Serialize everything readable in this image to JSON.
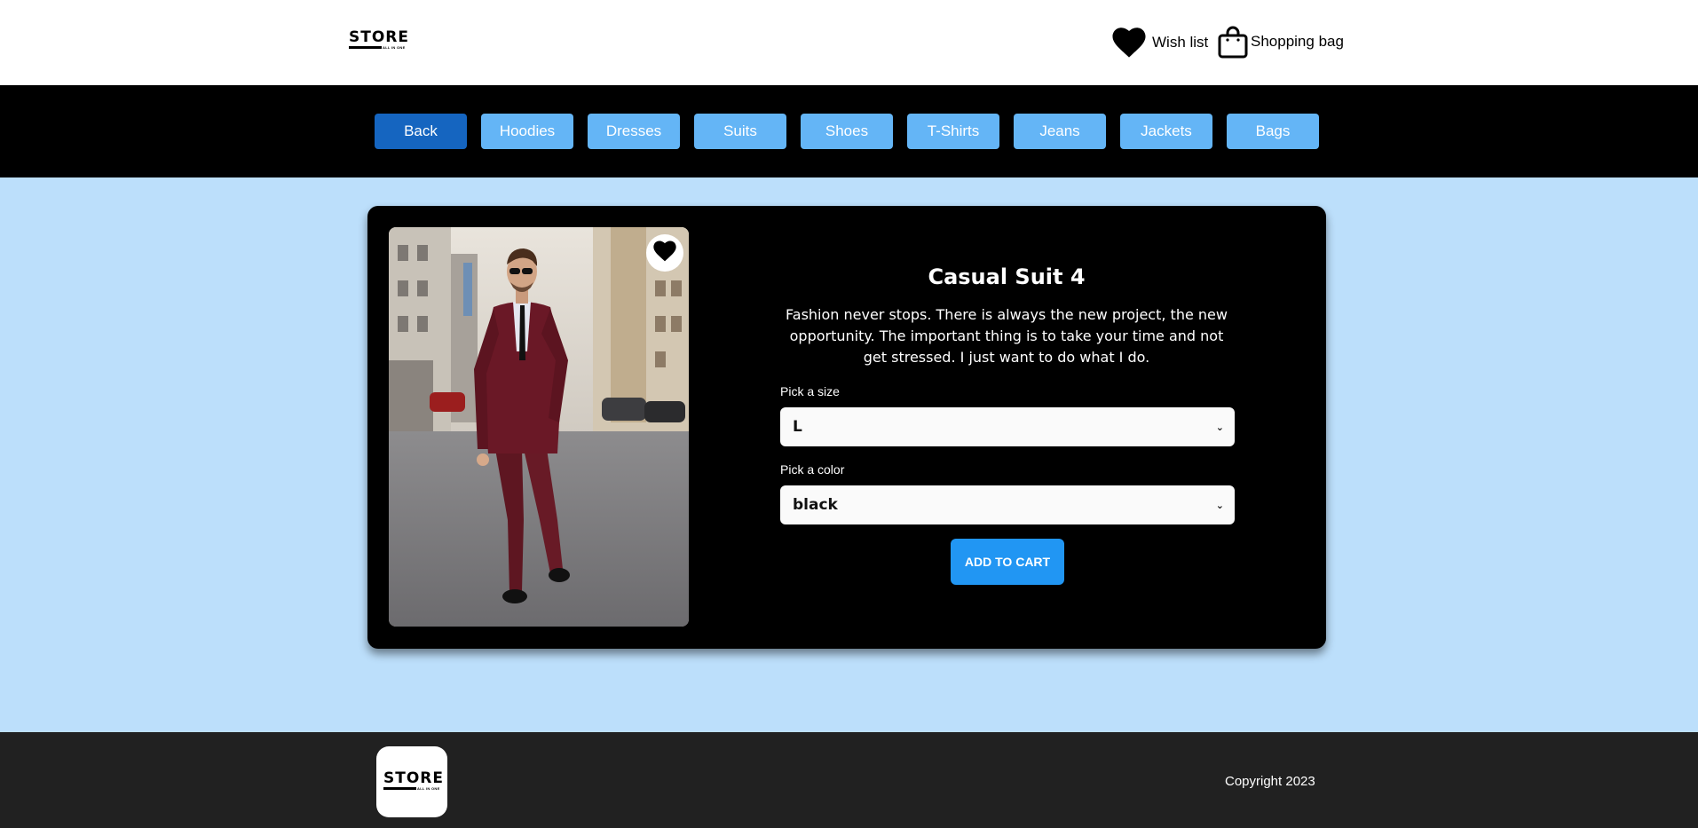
{
  "header": {
    "logo": {
      "word": "STORE",
      "tagline": "ALL IN ONE"
    },
    "wishlist_label": "Wish list",
    "bag_label": "Shopping bag"
  },
  "nav": {
    "items": [
      "Back",
      "Hoodies",
      "Dresses",
      "Suits",
      "Shoes",
      "T-Shirts",
      "Jeans",
      "Jackets",
      "Bags"
    ],
    "active": "Back"
  },
  "product": {
    "title": "Casual Suit 4",
    "description": "Fashion never stops. There is always the new project, the new opportunity. The important thing is to take your time and not get stressed. I just want to do what I do.",
    "size_label": "Pick a size",
    "size_value": "L",
    "color_label": "Pick a color",
    "color_value": "black",
    "add_label": "ADD TO CART"
  },
  "footer": {
    "copyright": "Copyright 2023"
  },
  "colors": {
    "page_bg": "#bcdffb",
    "nav_bg": "#000000",
    "nav_btn": "#64b5f6",
    "nav_btn_active": "#1565c0",
    "card_bg": "#000000",
    "accent": "#2196f3",
    "footer_bg": "#212121"
  },
  "icons": [
    "heart-icon",
    "shopping-bag-icon",
    "favorite-heart-icon",
    "chevron-down-icon"
  ]
}
